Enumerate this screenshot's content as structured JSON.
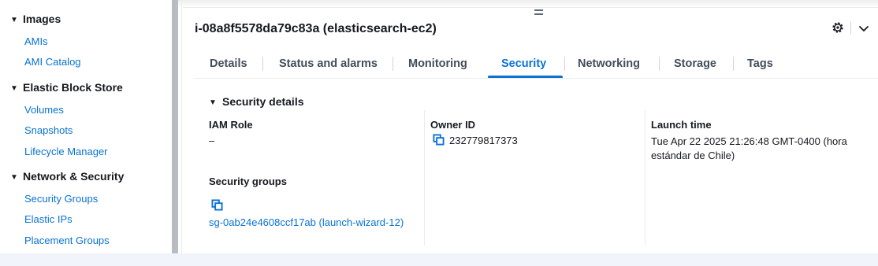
{
  "sidebar": {
    "sections": [
      {
        "title": "Images",
        "items": [
          "AMIs",
          "AMI Catalog"
        ]
      },
      {
        "title": "Elastic Block Store",
        "items": [
          "Volumes",
          "Snapshots",
          "Lifecycle Manager"
        ]
      },
      {
        "title": "Network & Security",
        "items": [
          "Security Groups",
          "Elastic IPs",
          "Placement Groups"
        ]
      }
    ]
  },
  "instance": {
    "title": "i-08a8f5578da79c83a (elasticsearch-ec2)"
  },
  "tabs": [
    "Details",
    "Status and alarms",
    "Monitoring",
    "Security",
    "Networking",
    "Storage",
    "Tags"
  ],
  "active_tab": "Security",
  "security_details": {
    "heading": "Security details",
    "iam_role_label": "IAM Role",
    "iam_role_value": "–",
    "owner_id_label": "Owner ID",
    "owner_id_value": "232779817373",
    "launch_time_label": "Launch time",
    "launch_time_value": "Tue Apr 22 2025 21:26:48 GMT-0400 (hora estándar de Chile)",
    "security_groups_label": "Security groups",
    "security_group_link": "sg-0ab24e4608ccf17ab (launch-wizard-12)"
  },
  "colors": {
    "accent": "#0972d3",
    "text": "#16191f",
    "muted": "#414d5c"
  },
  "icons": [
    "drag-handle-icon",
    "gear-icon",
    "chevron-down-icon",
    "copy-icon",
    "caret-down-icon"
  ]
}
